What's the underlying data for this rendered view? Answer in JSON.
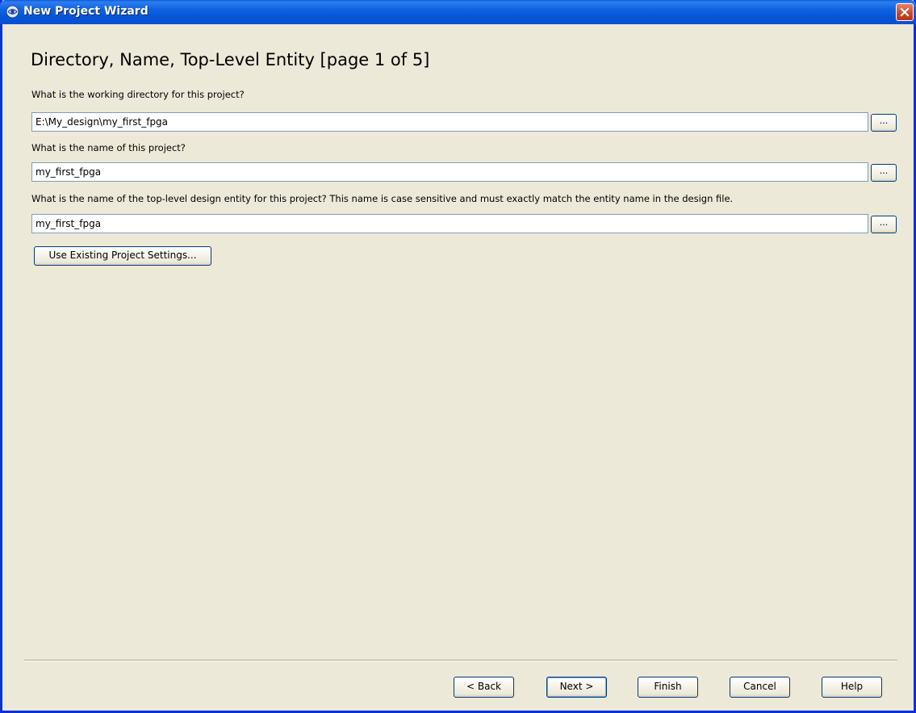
{
  "window": {
    "title": "New Project Wizard"
  },
  "page": {
    "heading": "Directory, Name, Top-Level Entity [page 1 of 5]"
  },
  "fields": [
    {
      "label": "What is the working directory for this project?",
      "value": "E:\\My_design\\my_first_fpga",
      "browse_label": "..."
    },
    {
      "label": "What is the name of this project?",
      "value": "my_first_fpga",
      "browse_label": "..."
    },
    {
      "label": "What is the name of the top-level design entity for this project? This name is case sensitive and must exactly match the entity name in the design file.",
      "value": "my_first_fpga",
      "browse_label": "..."
    }
  ],
  "buttons": {
    "use_existing": "Use Existing Project Settings...",
    "back": "< Back",
    "next": "Next >",
    "finish": "Finish",
    "cancel": "Cancel",
    "help": "Help"
  },
  "icons": {
    "app": "app-globe-icon",
    "close": "close-icon"
  },
  "colors": {
    "titlebar": "#0a5bd8",
    "dialog_bg": "#ece9d8",
    "close_button": "#c9452a"
  }
}
